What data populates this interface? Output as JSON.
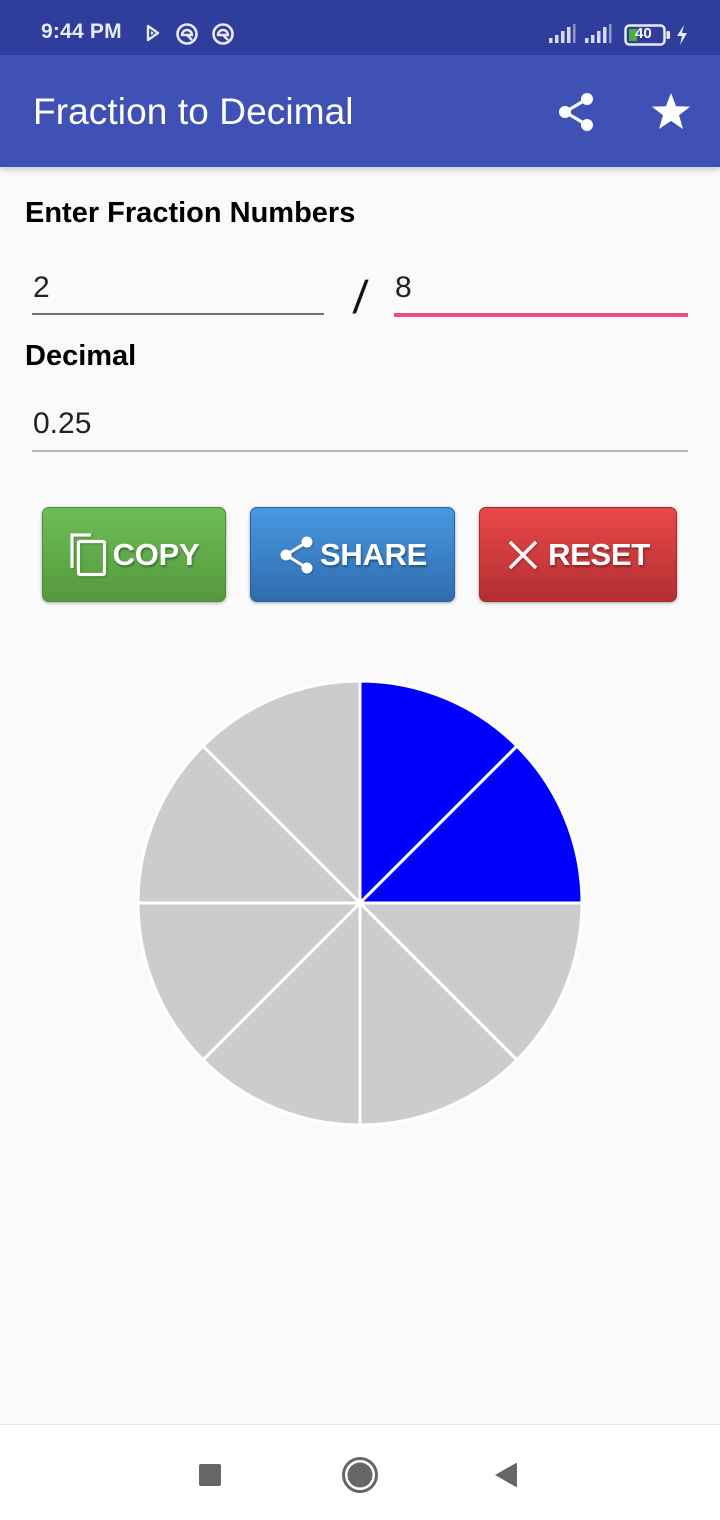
{
  "status_bar": {
    "time": "9:44 PM",
    "battery_level": "40",
    "icons": [
      "play-store-icon",
      "vpn-ring-icon",
      "vpn-ring-icon",
      "signal-icon",
      "signal-icon",
      "battery-icon",
      "charging-bolt-icon"
    ]
  },
  "app_bar": {
    "title": "Fraction to Decimal",
    "actions": [
      "share-icon",
      "star-icon"
    ]
  },
  "fraction": {
    "label": "Enter Fraction Numbers",
    "numerator": "2",
    "separator": "/",
    "denominator": "8",
    "focused_field": "denominator"
  },
  "decimal": {
    "label": "Decimal",
    "value": "0.25"
  },
  "buttons": {
    "copy": "COPY",
    "share": "SHARE",
    "reset": "RESET"
  },
  "colors": {
    "app_bar": "#3f51b5",
    "status_bar": "#2f3e9d",
    "focus_accent": "#e5508a",
    "pie_filled": "#0000ff",
    "pie_empty": "#cccccc",
    "copy_button": "#5fae48",
    "share_button": "#3b82c9",
    "reset_button": "#d13b3e"
  },
  "chart_data": {
    "type": "pie",
    "title": "",
    "total_slices": 8,
    "filled_slices": 2,
    "fraction": "2/8",
    "values": [
      1,
      1,
      1,
      1,
      1,
      1,
      1,
      1
    ],
    "filled": [
      true,
      true,
      false,
      false,
      false,
      false,
      false,
      false
    ],
    "start": "top",
    "direction": "clockwise"
  },
  "nav_bar": {
    "buttons": [
      "recents",
      "home",
      "back"
    ]
  }
}
